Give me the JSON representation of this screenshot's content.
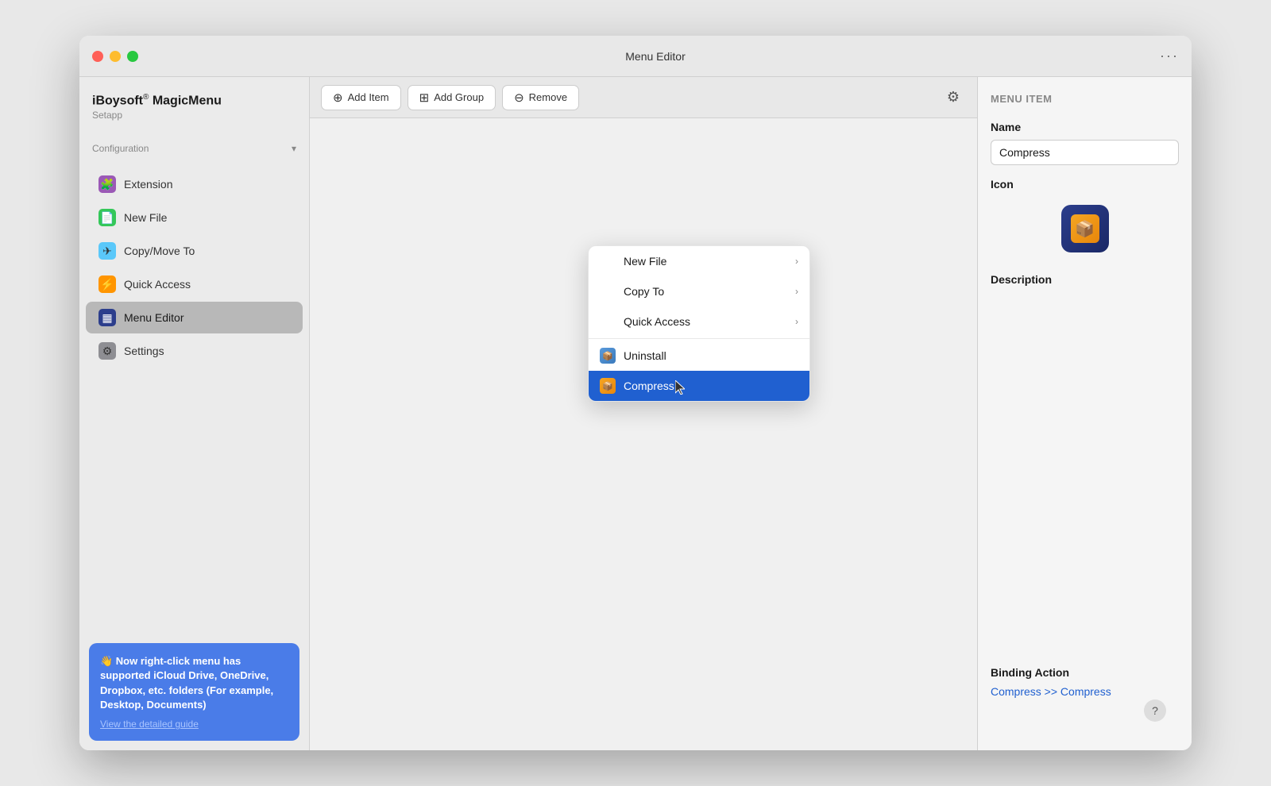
{
  "window": {
    "title": "Menu Editor",
    "more_label": "···"
  },
  "sidebar": {
    "app_name": "iBoysoft",
    "app_name_trademark": "®",
    "app_product": "MagicMenu",
    "app_sub": "Setapp",
    "config_label": "Configuration",
    "nav_items": [
      {
        "id": "extension",
        "label": "Extension",
        "icon": "🧩",
        "icon_class": "purple",
        "active": false
      },
      {
        "id": "new-file",
        "label": "New File",
        "icon": "📄",
        "icon_class": "green",
        "active": false
      },
      {
        "id": "copy-move-to",
        "label": "Copy/Move To",
        "icon": "✈",
        "icon_class": "blue-light",
        "active": false
      },
      {
        "id": "quick-access",
        "label": "Quick Access",
        "icon": "⚡",
        "icon_class": "yellow",
        "active": false
      },
      {
        "id": "menu-editor",
        "label": "Menu Editor",
        "icon": "▦",
        "icon_class": "blue-dark",
        "active": true
      },
      {
        "id": "settings",
        "label": "Settings",
        "icon": "⚙",
        "icon_class": "gray",
        "active": false
      }
    ],
    "notification": {
      "text": "👋 Now right-click menu has supported iCloud Drive, OneDrive, Dropbox, etc. folders (For example, Desktop, Documents)",
      "link": "View the detailed guide"
    }
  },
  "toolbar": {
    "add_item_label": "Add Item",
    "add_group_label": "Add Group",
    "remove_label": "Remove"
  },
  "context_menu": {
    "items": [
      {
        "id": "new-file",
        "label": "New File",
        "has_arrow": true,
        "has_icon": false,
        "selected": false
      },
      {
        "id": "copy-to",
        "label": "Copy To",
        "has_arrow": true,
        "has_icon": false,
        "selected": false
      },
      {
        "id": "quick-access",
        "label": "Quick Access",
        "has_arrow": true,
        "has_icon": false,
        "selected": false
      },
      {
        "id": "uninstall",
        "label": "Uninstall",
        "has_arrow": false,
        "has_icon": true,
        "selected": false
      },
      {
        "id": "compress",
        "label": "Compress",
        "has_arrow": false,
        "has_icon": true,
        "selected": true
      }
    ]
  },
  "right_panel": {
    "section_title": "Menu Item",
    "name_label": "Name",
    "name_value": "Compress",
    "icon_label": "Icon",
    "description_label": "Description",
    "binding_action_label": "Binding Action",
    "binding_action_value": "Compress >> Compress"
  }
}
